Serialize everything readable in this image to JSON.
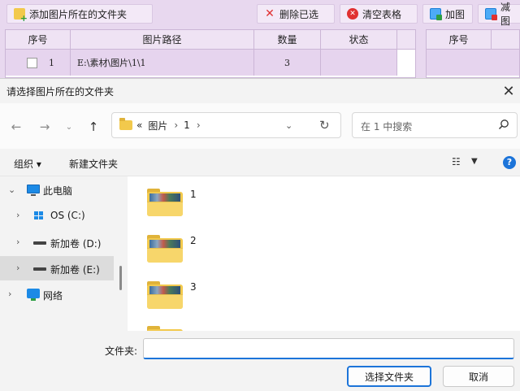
{
  "app": {
    "toolbar": {
      "add_folder": "添加图片所在的文件夹",
      "delete_selected": "删除已选",
      "clear_table": "清空表格",
      "add_image": "加图",
      "remove_image": "减图"
    },
    "table": {
      "columns": [
        "序号",
        "图片路径",
        "数量",
        "状态"
      ],
      "rows": [
        {
          "index": "1",
          "path": "E:\\素材\\图片\\1\\1",
          "count": "3",
          "status": ""
        }
      ]
    },
    "table2": {
      "columns": [
        "序号"
      ]
    }
  },
  "dialog": {
    "title": "请选择图片所在的文件夹",
    "address": {
      "overflow": "«",
      "crumbs": [
        "图片",
        "1"
      ]
    },
    "search_placeholder": "在 1 中搜索",
    "commands": {
      "organize": "组织",
      "new_folder": "新建文件夹"
    },
    "tree": [
      {
        "label": "此电脑",
        "icon": "pc-icon"
      },
      {
        "label": "OS (C:)",
        "icon": "windows-drive-icon"
      },
      {
        "label": "新加卷 (D:)",
        "icon": "drive-icon"
      },
      {
        "label": "新加卷 (E:)",
        "icon": "drive-icon",
        "selected": true
      },
      {
        "label": "网络",
        "icon": "network-icon"
      }
    ],
    "folders": [
      "1",
      "2",
      "3"
    ],
    "folder_label": "文件夹:",
    "folder_value": "",
    "buttons": {
      "select": "选择文件夹",
      "cancel": "取消"
    }
  }
}
